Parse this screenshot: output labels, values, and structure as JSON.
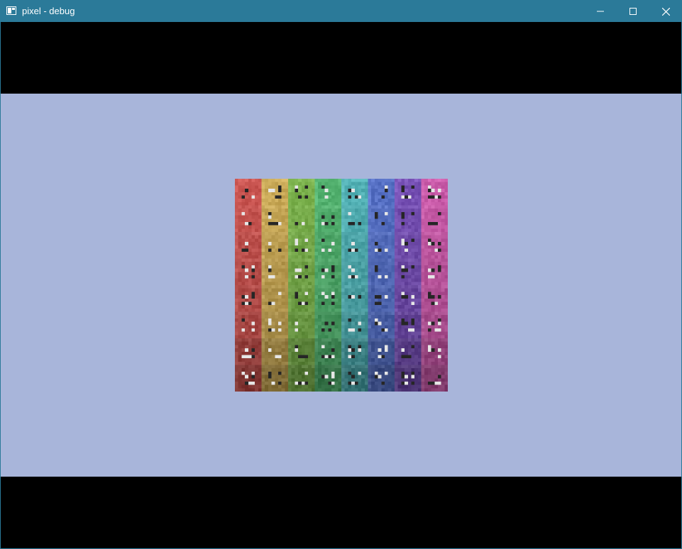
{
  "window": {
    "title": "pixel - debug",
    "icon": "app-window-icon",
    "controls": {
      "minimize": "minimize-icon",
      "maximize": "maximize-icon",
      "close": "close-icon"
    }
  },
  "colors": {
    "titlebar": "#2b7a99",
    "letterbox": "#000000",
    "viewport_background": "#a8b5da"
  },
  "tileset": {
    "columns": 8,
    "rows": 8,
    "column_colors": [
      "#c85450",
      "#c8a856",
      "#7ab04c",
      "#52b06e",
      "#52b0b4",
      "#5670c4",
      "#7650b4",
      "#c85aa8"
    ],
    "row_shades": [
      1.0,
      0.97,
      0.93,
      0.9,
      0.87,
      0.82,
      0.72,
      0.64
    ]
  }
}
